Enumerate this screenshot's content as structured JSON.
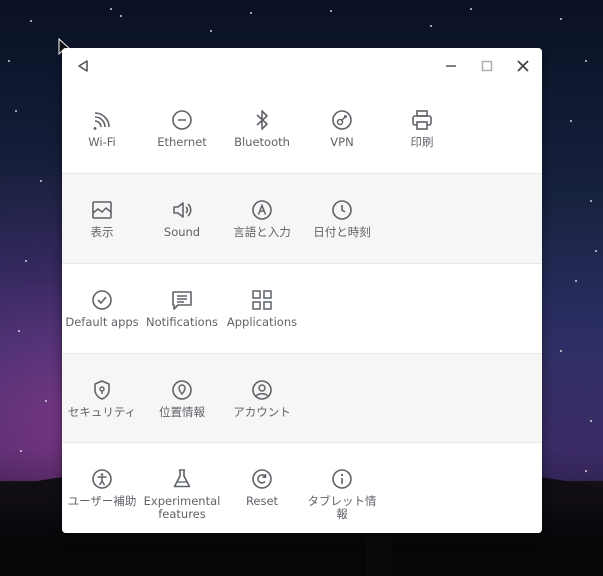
{
  "window": {
    "back_icon": "back-triangle-icon",
    "minimize_icon": "minimize-icon",
    "maximize_icon": "maximize-icon",
    "close_icon": "close-icon"
  },
  "sections": [
    {
      "items": [
        {
          "name": "wifi",
          "label": "Wi-Fi",
          "icon": "wifi-icon"
        },
        {
          "name": "ethernet",
          "label": "Ethernet",
          "icon": "ethernet-icon"
        },
        {
          "name": "bluetooth",
          "label": "Bluetooth",
          "icon": "bluetooth-icon"
        },
        {
          "name": "vpn",
          "label": "VPN",
          "icon": "vpn-key-icon"
        },
        {
          "name": "print",
          "label": "印刷",
          "icon": "printer-icon"
        }
      ]
    },
    {
      "items": [
        {
          "name": "display",
          "label": "表示",
          "icon": "image-icon"
        },
        {
          "name": "sound",
          "label": "Sound",
          "icon": "speaker-icon"
        },
        {
          "name": "language-input",
          "label": "言語と入力",
          "icon": "keyboard-a-icon"
        },
        {
          "name": "date-time",
          "label": "日付と時刻",
          "icon": "clock-icon"
        }
      ]
    },
    {
      "items": [
        {
          "name": "default-apps",
          "label": "Default apps",
          "icon": "check-circle-icon"
        },
        {
          "name": "notifications",
          "label": "Notifications",
          "icon": "message-icon"
        },
        {
          "name": "applications",
          "label": "Applications",
          "icon": "apps-grid-icon"
        }
      ]
    },
    {
      "items": [
        {
          "name": "security",
          "label": "セキュリティ",
          "icon": "shield-icon"
        },
        {
          "name": "location",
          "label": "位置情報",
          "icon": "location-pin-icon"
        },
        {
          "name": "account",
          "label": "アカウント",
          "icon": "account-circle-icon"
        }
      ]
    },
    {
      "items": [
        {
          "name": "accessibility",
          "label": "ユーザー補助",
          "icon": "accessibility-icon"
        },
        {
          "name": "experimental",
          "label": "Experimental features",
          "icon": "flask-icon"
        },
        {
          "name": "reset",
          "label": "Reset",
          "icon": "reset-icon"
        },
        {
          "name": "tablet-info",
          "label": "タブレット情報",
          "icon": "info-icon"
        }
      ]
    }
  ]
}
